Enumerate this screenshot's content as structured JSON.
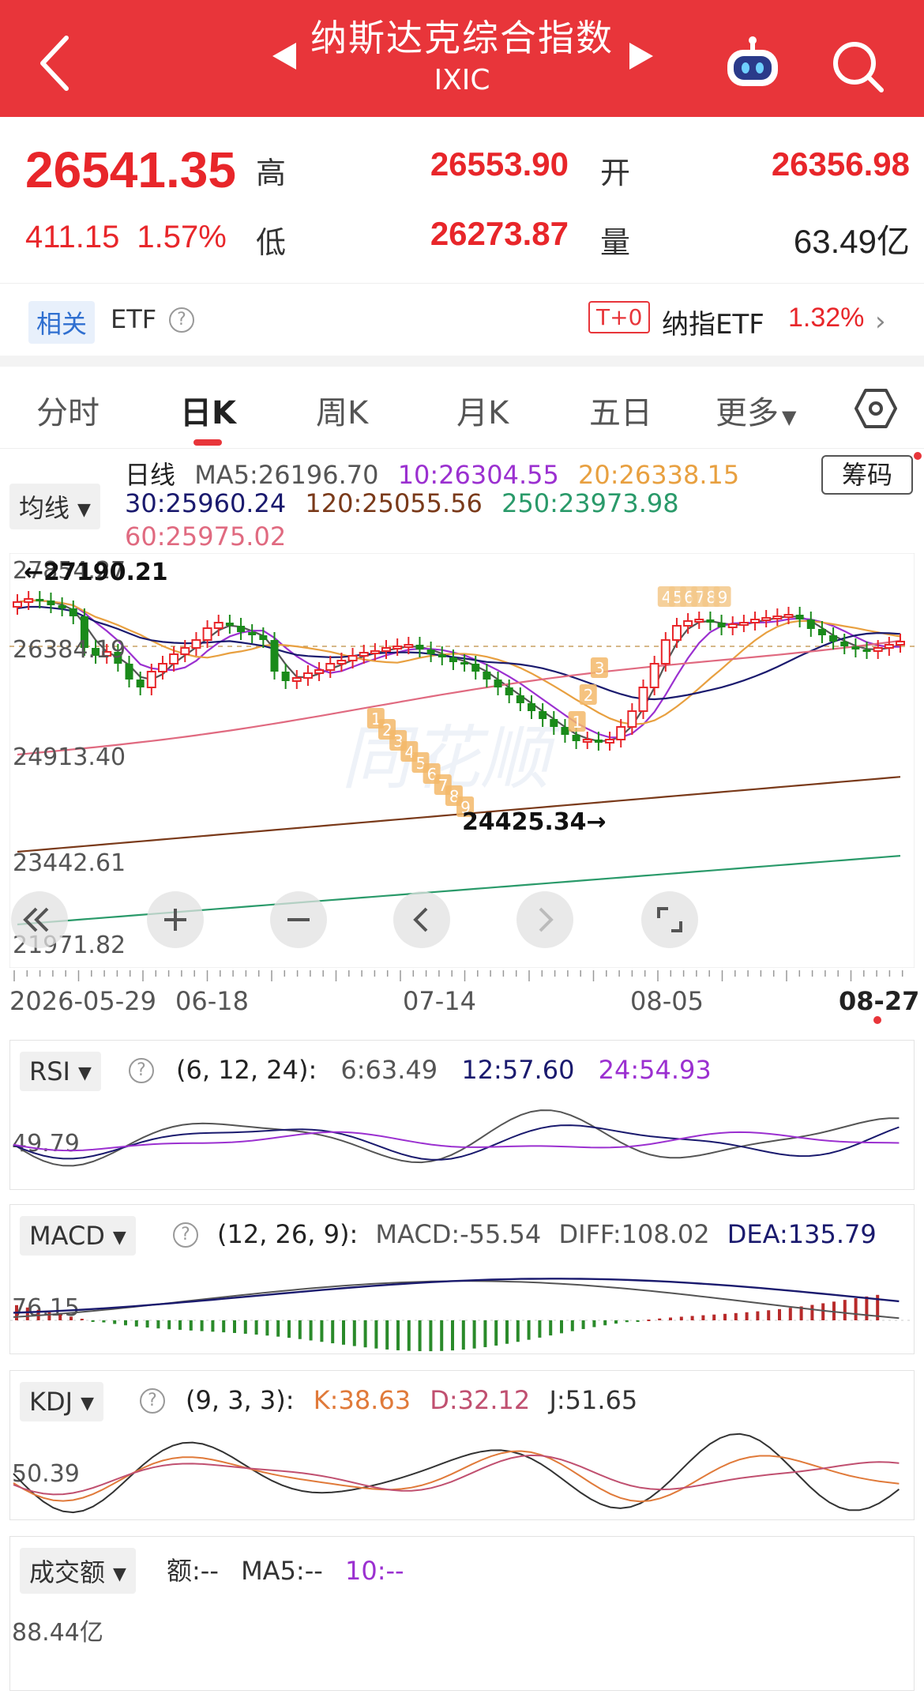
{
  "header": {
    "title": "纳斯达克综合指数",
    "subtitle": "IXIC"
  },
  "quote": {
    "price": "26541.35",
    "change": "411.15",
    "change_pct": "1.57%",
    "high_label": "高",
    "high": "26553.90",
    "open_label": "开",
    "open": "26356.98",
    "low_label": "低",
    "low": "26273.87",
    "volume_label": "量",
    "volume": "63.49亿"
  },
  "etf": {
    "related_tag": "相关",
    "label": "ETF",
    "t0_tag": "T+0",
    "name": "纳指ETF",
    "pct": "1.32%"
  },
  "tabs": [
    {
      "label": "分时"
    },
    {
      "label": "日K"
    },
    {
      "label": "周K"
    },
    {
      "label": "月K"
    },
    {
      "label": "五日"
    },
    {
      "label": "更多"
    }
  ],
  "ma": {
    "dropdown": "均线",
    "period": "日线",
    "ma5": "MA5:26196.70",
    "ma10": "10:26304.55",
    "ma20": "20:26338.15",
    "ma30": "30:25960.24",
    "ma120": "120:25055.56",
    "ma250": "250:23973.98",
    "ma60": "60:25975.02",
    "chip_button": "筹码"
  },
  "colors": {
    "up": "#e8262a",
    "down": "#1a8a1a",
    "ma5": "#555555",
    "ma10": "#9b30d0",
    "ma20": "#e8a040",
    "ma30": "#1a1a6e",
    "ma60": "#e06a80",
    "ma120": "#7a3a1a",
    "ma250": "#2a9a6a"
  },
  "kline": {
    "y_labels": [
      "27854.27",
      "26384.19",
      "24913.40",
      "23442.61",
      "21971.82"
    ],
    "max_annot": "←27190.21",
    "min_annot": "24425.34→",
    "dates": [
      "2026-05-29",
      "06-18",
      "07-14",
      "08-05",
      "08-27"
    ],
    "td_low": [
      "1",
      "2",
      "3",
      "4",
      "5",
      "6",
      "7",
      "8",
      "9"
    ],
    "td_mid": [
      "1",
      "2",
      "3"
    ],
    "td_high": [
      "4",
      "5",
      "6",
      "7",
      "8",
      "9"
    ]
  },
  "rsi": {
    "dropdown": "RSI",
    "params": "(6, 12, 24):",
    "v6": "6:63.49",
    "v12": "12:57.60",
    "v24": "24:54.93",
    "axis": "49.79"
  },
  "macd": {
    "dropdown": "MACD",
    "params": "(12, 26, 9):",
    "macd": "MACD:-55.54",
    "diff": "DIFF:108.02",
    "dea": "DEA:135.79",
    "axis": "76.15"
  },
  "kdj": {
    "dropdown": "KDJ",
    "params": "(9, 3, 3):",
    "k": "K:38.63",
    "d": "D:32.12",
    "j": "J:51.65",
    "axis": "50.39"
  },
  "turnover": {
    "dropdown": "成交额",
    "amount": "额:--",
    "ma5": "MA5:--",
    "ma10": "10:--",
    "axis": "88.44亿"
  }
}
